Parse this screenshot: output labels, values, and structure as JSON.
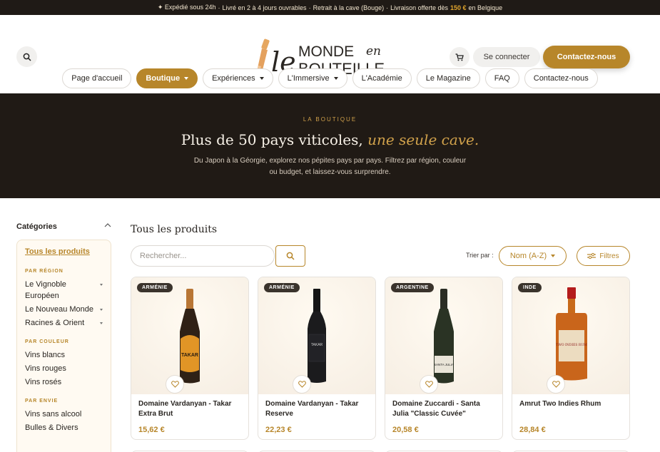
{
  "topbar": {
    "segments": [
      "✦ Expédié sous 24h",
      "·",
      "Livré en 2 à 4 jours ouvrables",
      "·",
      "Retrait à la cave (Bouge)",
      "·",
      "Livraison offerte dès"
    ],
    "highlight": "150 €",
    "suffix": "en Belgique"
  },
  "header": {
    "logo_words": [
      "le",
      "MONDE",
      "en",
      "BOUTEILLE"
    ],
    "login_label": "Se connecter",
    "contact_label": "Contactez-nous",
    "icons": [
      "search-icon",
      "cart-icon"
    ]
  },
  "nav": {
    "items": [
      {
        "label": "Page d'accueil",
        "dropdown": false,
        "active": false
      },
      {
        "label": "Boutique",
        "dropdown": true,
        "active": true
      },
      {
        "label": "Expériences",
        "dropdown": true,
        "active": false
      },
      {
        "label": "L'Immersive",
        "dropdown": true,
        "active": false
      },
      {
        "label": "L'Académie",
        "dropdown": false,
        "active": false
      },
      {
        "label": "Le Magazine",
        "dropdown": false,
        "active": false
      },
      {
        "label": "FAQ",
        "dropdown": false,
        "active": false
      },
      {
        "label": "Contactez-nous",
        "dropdown": false,
        "active": false
      }
    ]
  },
  "hero": {
    "eyebrow": "LA BOUTIQUE",
    "title_main": "Plus de 50 pays viticoles,",
    "title_accent": "une seule cave.",
    "subtitle": "Du Japon à la Géorgie, explorez nos pépites pays par pays. Filtrez par région, couleur ou budget, et laissez-vous surprendre."
  },
  "sidebar": {
    "title": "Catégories",
    "all_products": "Tous les produits",
    "groups": [
      {
        "label": "PAR RÉGION",
        "links": [
          "Le Vignoble Européen",
          "Le Nouveau Monde",
          "Racines & Orient"
        ]
      },
      {
        "label": "PAR COULEUR",
        "links": [
          "Vins blancs",
          "Vins rouges",
          "Vins rosés"
        ]
      },
      {
        "label": "PAR ENVIE",
        "links": [
          "Vins sans alcool",
          "Bulles & Divers"
        ]
      }
    ]
  },
  "products_section": {
    "title": "Tous les produits",
    "search_placeholder": "Rechercher...",
    "sort_label": "Trier par :",
    "sort_value": "Nom (A-Z)",
    "filters_label": "Filtres"
  },
  "products": [
    {
      "badge": "ARMÉNIE",
      "name": "Domaine Vardanyan - Takar Extra Brut",
      "price": "15,62 €",
      "label_text": "TAKAR"
    },
    {
      "badge": "ARMÉNIE",
      "name": "Domaine Vardanyan - Takar Reserve",
      "price": "22,23 €",
      "label_text": "TAKAR"
    },
    {
      "badge": "ARGENTINE",
      "name": "Domaine Zuccardi - Santa Julia \"Classic Cuvée\"",
      "price": "20,58 €",
      "label_text": "SANTA JULIA"
    },
    {
      "badge": "INDE",
      "name": "Amrut Two Indies Rhum",
      "price": "28,84 €",
      "label_text": "TWO INDIES RUM"
    }
  ],
  "colors": {
    "accent": "#b7862a",
    "dark": "#201a15",
    "cream": "#fffaf2"
  }
}
